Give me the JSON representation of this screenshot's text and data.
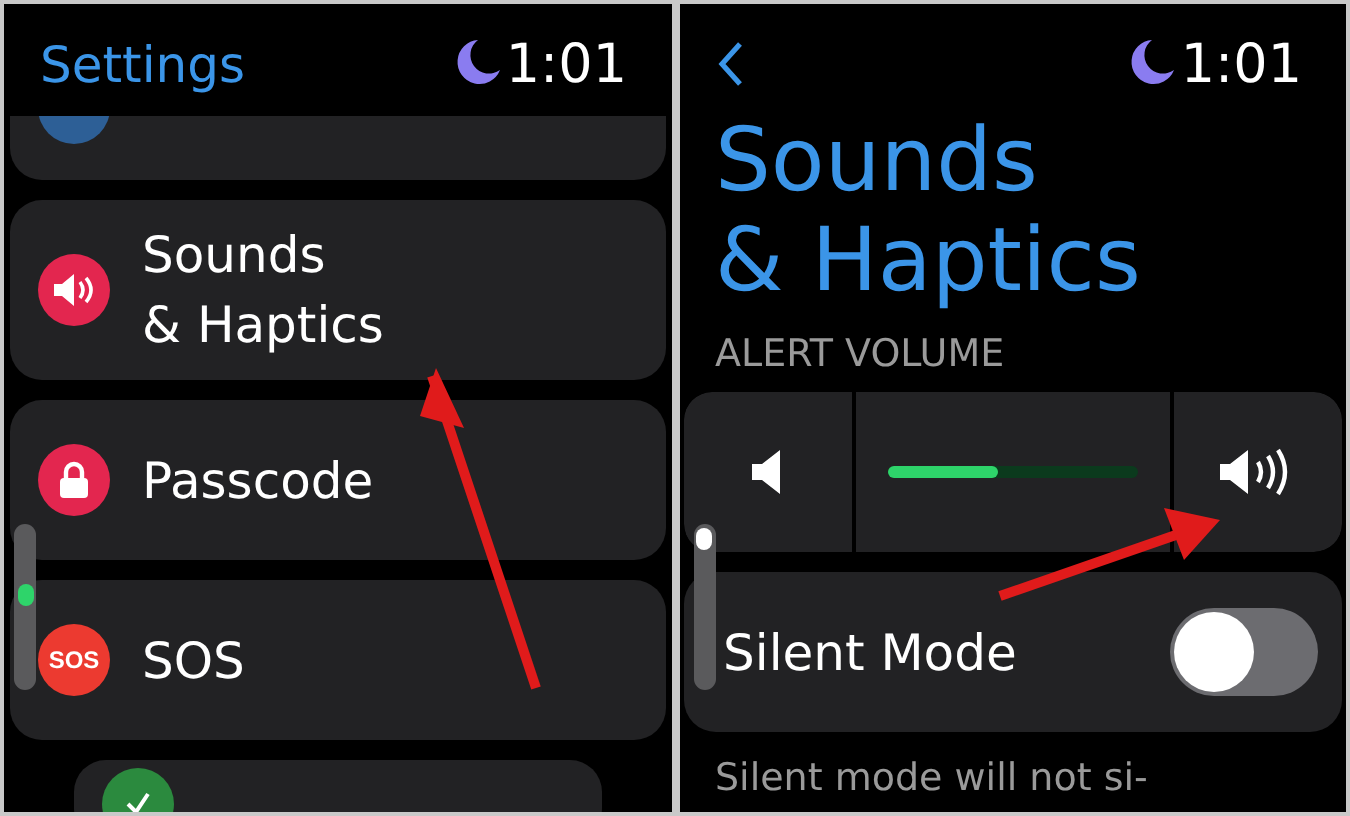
{
  "settings_screen": {
    "title": "Settings",
    "time": "1:01",
    "items": [
      {
        "kind": "cut",
        "color": "#2d5f96"
      },
      {
        "kind": "row",
        "color": "#e3264f",
        "label_lines": [
          "Sounds",
          "& Haptics"
        ]
      },
      {
        "kind": "row",
        "color": "#e3264f",
        "label_lines": [
          "Passcode"
        ]
      },
      {
        "kind": "row",
        "icon_text": "SOS",
        "color": "#ec3a30",
        "label_lines": [
          "SOS"
        ]
      },
      {
        "kind": "cut-inset",
        "color": "#2b8a3e"
      }
    ]
  },
  "sounds_screen": {
    "time": "1:01",
    "title_lines": [
      "Sounds",
      "& Haptics"
    ],
    "section": "ALERT VOLUME",
    "volume": {
      "level": 0.44
    },
    "silent_mode": {
      "label": "Silent Mode",
      "on": false
    },
    "footnote": "Silent mode will not si-"
  }
}
